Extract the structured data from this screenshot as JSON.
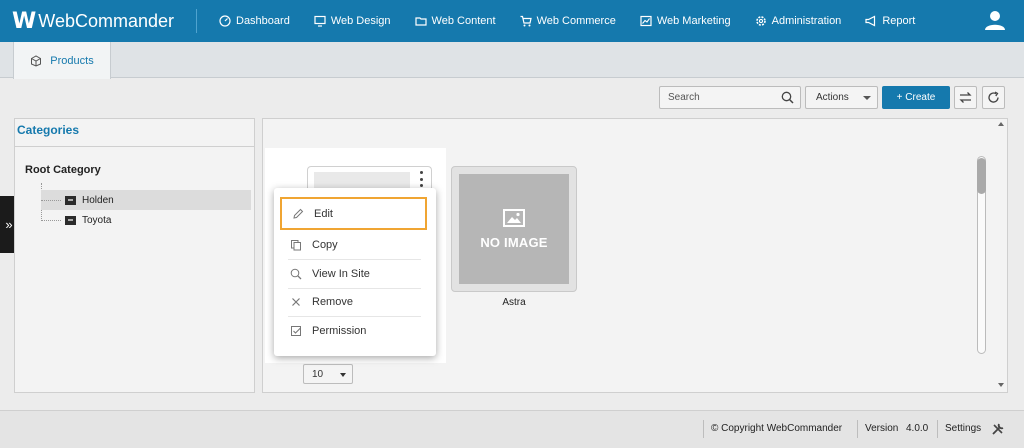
{
  "app": {
    "logo_mark": "W",
    "logo_text": "WebCommander"
  },
  "nav": {
    "items": [
      {
        "label": "Dashboard",
        "icon": "dashboard-icon"
      },
      {
        "label": "Web Design",
        "icon": "monitor-icon"
      },
      {
        "label": "Web Content",
        "icon": "folder-icon"
      },
      {
        "label": "Web Commerce",
        "icon": "cart-icon"
      },
      {
        "label": "Web Marketing",
        "icon": "chart-icon"
      },
      {
        "label": "Administration",
        "icon": "gear-icon"
      },
      {
        "label": "Report",
        "icon": "megaphone-icon"
      }
    ],
    "user_icon": "user-icon"
  },
  "tabs": [
    {
      "label": "Products",
      "icon": "box-icon",
      "active": true
    }
  ],
  "toolbar": {
    "search_placeholder": "Search",
    "actions_label": "Actions",
    "create_label": "+ Create"
  },
  "categories": {
    "title": "Categories",
    "root": "Root Category",
    "items": [
      {
        "label": "Holden",
        "selected": true
      },
      {
        "label": "Toyota",
        "selected": false
      }
    ]
  },
  "products": {
    "cards": [
      {
        "name": "Astra",
        "image_text": "NO IMAGE"
      }
    ],
    "page_size": "10"
  },
  "context_menu": {
    "items": [
      {
        "label": "Edit",
        "icon": "pencil-icon",
        "highlighted": true
      },
      {
        "label": "Copy",
        "icon": "copy-icon"
      },
      {
        "label": "View In Site",
        "icon": "magnify-icon"
      },
      {
        "label": "Remove",
        "icon": "close-icon"
      },
      {
        "label": "Permission",
        "icon": "checkbox-icon"
      }
    ]
  },
  "footer": {
    "copyright": "© Copyright WebCommander",
    "version_label": "Version",
    "version": "4.0.0",
    "settings": "Settings"
  },
  "colors": {
    "brand": "#1579ad",
    "highlight": "#f0a532"
  }
}
